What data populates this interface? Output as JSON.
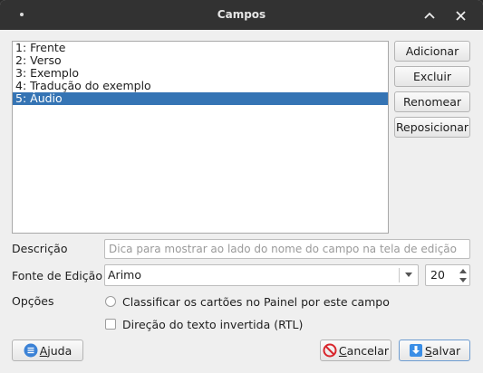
{
  "window": {
    "title": "Campos"
  },
  "fields": [
    {
      "label": "1: Frente",
      "selected": false
    },
    {
      "label": "2: Verso",
      "selected": false
    },
    {
      "label": "3: Exemplo",
      "selected": false
    },
    {
      "label": "4: Tradução do exemplo",
      "selected": false
    },
    {
      "label": "5: Áudio",
      "selected": true
    }
  ],
  "side_buttons": {
    "add": "Adicionar",
    "delete": "Excluir",
    "rename": "Renomear",
    "reposition": "Reposicionar"
  },
  "description": {
    "label": "Descrição",
    "value": "",
    "placeholder": "Dica para mostrar ao lado do nome do campo na tela de edição"
  },
  "edit_font": {
    "label": "Fonte de Edição",
    "font": "Arimo",
    "size": "20"
  },
  "options": {
    "label": "Opções",
    "sort_field": {
      "text": "Classificar os cartões no Painel por este campo",
      "checked": false
    },
    "rtl": {
      "text": "Direção do texto invertida (RTL)",
      "checked": false
    }
  },
  "bottom_buttons": {
    "help": {
      "mnemonic": "A",
      "rest": "juda"
    },
    "cancel": {
      "mnemonic": "C",
      "rest": "ancelar"
    },
    "save": {
      "mnemonic": "S",
      "rest": "alvar"
    }
  },
  "colors": {
    "selection": "#3574b4",
    "titlebar": "#323232",
    "help_icon": "#3b82d6",
    "cancel_icon": "#d9262c",
    "save_icon": "#3a8ee6"
  }
}
